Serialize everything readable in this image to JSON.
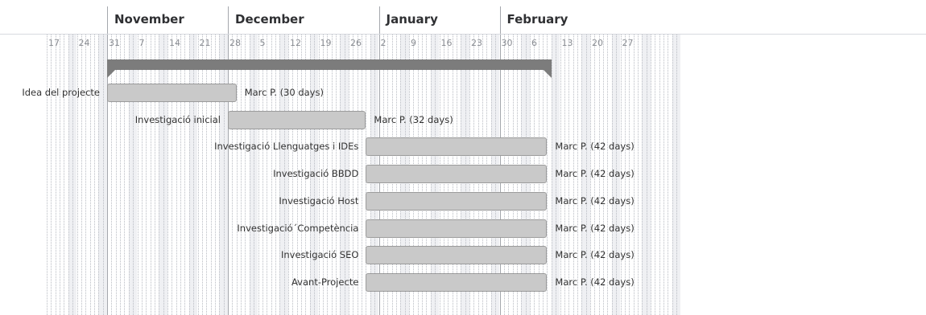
{
  "timeline": {
    "months": [
      {
        "label": "November",
        "start": "2022-10-31"
      },
      {
        "label": "December",
        "start": "2022-11-28"
      },
      {
        "label": "January",
        "start": "2023-01-02"
      },
      {
        "label": "February",
        "start": "2023-01-30"
      }
    ],
    "week_labels": [
      "17",
      "24",
      "31",
      "7",
      "14",
      "21",
      "28",
      "5",
      "12",
      "19",
      "26",
      "2",
      "9",
      "16",
      "23",
      "30",
      "6",
      "13",
      "20",
      "27"
    ],
    "first_week_start": "2022-10-17"
  },
  "summary": {
    "start": "2022-10-31",
    "end": "2023-02-10"
  },
  "tasks": [
    {
      "name": "Idea del projecte",
      "start": "2022-10-31",
      "end": "2022-11-29",
      "info": "Marc P. (30 days)"
    },
    {
      "name": "Investigació inicial",
      "start": "2022-11-28",
      "end": "2022-12-29",
      "info": "Marc P. (32 days)"
    },
    {
      "name": "Investigació Llenguatges i IDEs",
      "start": "2022-12-30",
      "end": "2023-02-09",
      "info": "Marc P. (42 days)"
    },
    {
      "name": "Investigació BBDD",
      "start": "2022-12-30",
      "end": "2023-02-09",
      "info": "Marc P. (42 days)"
    },
    {
      "name": "Investigació Host",
      "start": "2022-12-30",
      "end": "2023-02-09",
      "info": "Marc P. (42 days)"
    },
    {
      "name": "Investigació´Competència",
      "start": "2022-12-30",
      "end": "2023-02-09",
      "info": "Marc P. (42 days)"
    },
    {
      "name": "Investigació SEO",
      "start": "2022-12-30",
      "end": "2023-02-09",
      "info": "Marc P. (42 days)"
    },
    {
      "name": "Avant-Projecte",
      "start": "2022-12-30",
      "end": "2023-02-09",
      "info": "Marc P. (42 days)"
    }
  ],
  "colors": {
    "task_fill": "#c9c9c9",
    "task_border": "#9c9c9c",
    "summary": "#7c7c7c",
    "weekend_band": "#eff0f3"
  }
}
